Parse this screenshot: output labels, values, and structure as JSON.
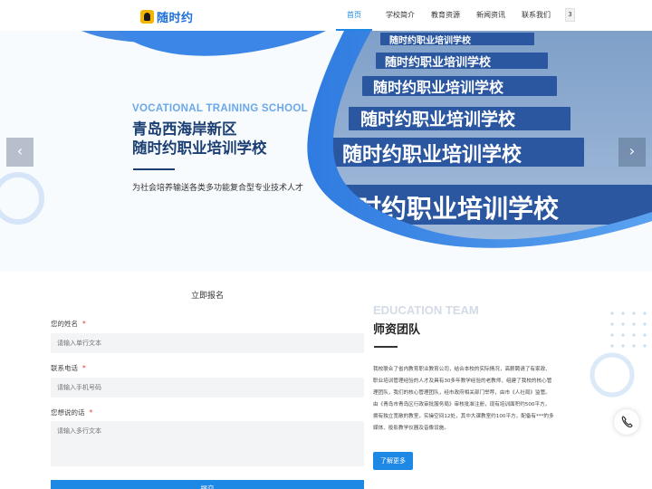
{
  "nav": {
    "logo_text": "随时约",
    "items": [
      {
        "label": "首页",
        "active": true
      },
      {
        "label": "学校简介",
        "active": false
      },
      {
        "label": "教育资源",
        "active": false
      },
      {
        "label": "新闻资讯",
        "active": false
      },
      {
        "label": "联系我们",
        "active": false
      }
    ],
    "more_label": "3"
  },
  "hero": {
    "english_label": "VOCATIONAL TRAINING SCHOOL",
    "title_line1": "青岛西海岸新区",
    "title_line2": "随时约职业培训学校",
    "subtitle": "为社会培养输送各类多功能复合型专业技术人才",
    "banner_text_brand": "随时约",
    "banner_text_rest": "职业培训学校",
    "prev_icon": "chevron-left-icon",
    "next_icon": "chevron-right-icon"
  },
  "form": {
    "title": "立即报名",
    "required_mark": "*",
    "name_label": "您的姓名",
    "name_placeholder": "请输入单行文本",
    "phone_label": "联系电话",
    "phone_placeholder": "请输入手机号码",
    "message_label": "您想说的话",
    "message_placeholder": "请输入多行文本",
    "submit_label": "提交"
  },
  "team": {
    "english_label": "EDUCATION TEAM",
    "title": "师资团队",
    "body_lines": [
      "我校联合了省内教育职业教育公司，结合本校的实际情况，高薪聘请了有家政、",
      "职业培训管理经验的人才及具有30多年教学经验的老教师，组建了我校的核心管",
      "理团队，我们的核心管理团队，经市政府相关部门举荐，由市《人社局》监管。",
      "由《青岛市青岛区行政审批服务局》审核批准注册，现有培训面积约500平方，",
      "拥有独立宽敞的教室，实操空间12处，其中大课教室约100平方，配备有***的多",
      "媒体、投影教学仪器及音像设施。"
    ],
    "more_label": "了解更多"
  },
  "floating": {
    "phone_icon": "phone-icon"
  },
  "colors": {
    "accent": "#1e88e5",
    "hero_title": "#1c3f73",
    "hero_english": "#6ba8e8",
    "banner_plate": "#2b56a0"
  }
}
